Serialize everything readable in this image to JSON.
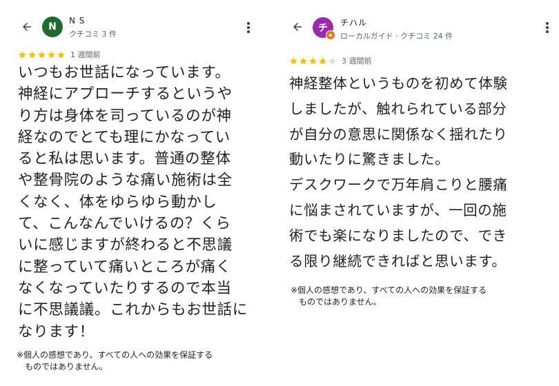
{
  "reviews": [
    {
      "reviewer_name": "N S",
      "avatar_initial": "N",
      "avatar_color": "#1e6b2f",
      "reviewer_meta": "クチコミ 3 件",
      "rating": 5,
      "date": "1 週間前",
      "text": "いつもお世話になっています。\n神経にアプローチするというや\nり方は身体を司っているのが神\n経なのでとても理にかなってい\nると私は思います。普通の整体\nや整骨院のような痛い施術は全\nくなく、体をゆらゆら動かし\nて、こんなんでいけるの？くら\nいに感じますが終わると不思議\nに整っていて痛いところが痛く\nなくなっていたりするので本当\nに不思議議。これからもお世話に\nなります！",
      "disclaimer": "※個人の感想であり、すべての人への効果を保証する\n　ものではありません。"
    },
    {
      "reviewer_name": "チハル",
      "avatar_initial": "チ",
      "avatar_color": "#9c27b0",
      "local_guide_badge_color": "#e8710a",
      "reviewer_meta": "ローカルガイド · クチコミ 24 件",
      "rating": 4,
      "date": "3 週間前",
      "text": "神経整体というものを初めて体験\nしましたが、触れられている部分\nが自分の意思に関係なく揺れたり\n動いたりに驚きました。\nデスクワークで万年肩こりと腰痛\nに悩まされていますが、一回の施\n術でも楽になりましたので、でき\nる限り継続できればと思います。",
      "disclaimer": "※個人の感想であり、すべての人への効果を保証する\n　ものではありません。"
    }
  ],
  "icons": {
    "back": "arrow-left-icon",
    "menu": "more-vert-icon",
    "star": "star-icon",
    "badge": "local-guide-badge-icon"
  },
  "colors": {
    "star_filled": "#fbbc04",
    "star_empty": "#dadce0",
    "text": "#202124",
    "secondary_text": "#5f6368"
  }
}
